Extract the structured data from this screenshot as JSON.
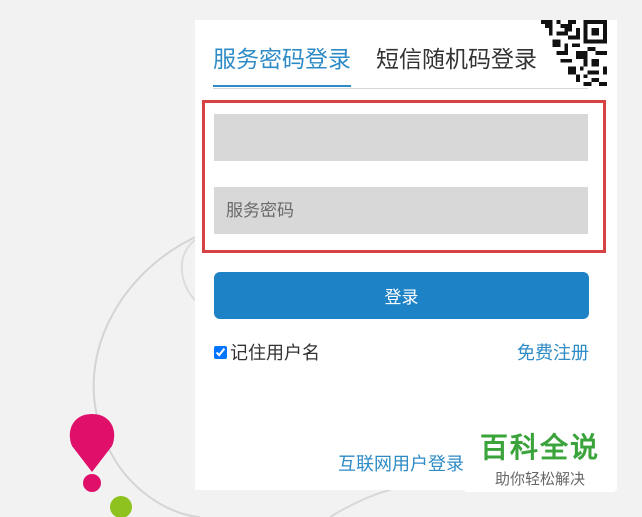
{
  "tabs": {
    "service_password": "服务密码登录",
    "sms_code": "短信随机码登录"
  },
  "form": {
    "username_value": "",
    "password_placeholder": "服务密码",
    "login_button": "登录"
  },
  "options": {
    "remember_label": "记住用户名",
    "remember_checked": true,
    "register_link": "免费注册"
  },
  "footer": {
    "internet_login": "互联网用户登录"
  },
  "watermark": {
    "title": "百科全说",
    "subtitle": "助你轻松解决"
  },
  "colors": {
    "accent": "#2e8bc6",
    "button": "#1e82c6",
    "highlight": "#d64141",
    "pin_pink": "#e0106a",
    "pin_green": "#8dc21f"
  },
  "icons": {
    "qr": "qr-code-icon",
    "pin": "location-pin-icon"
  }
}
